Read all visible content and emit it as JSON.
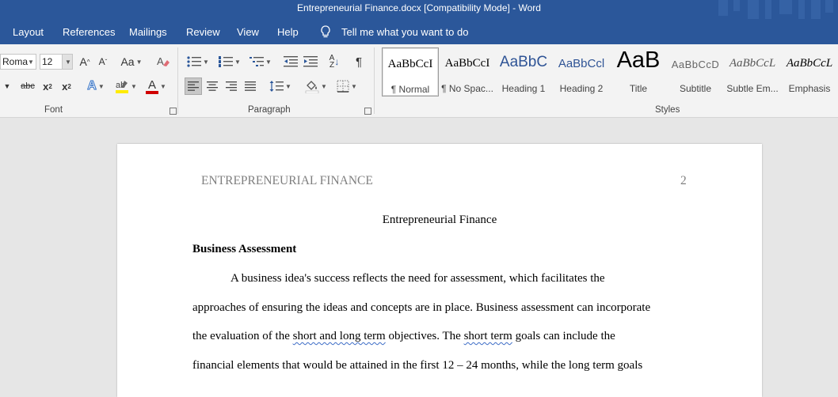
{
  "window": {
    "title": "Entrepreneurial Finance.docx [Compatibility Mode]  -  Word"
  },
  "tabs": [
    "Layout",
    "References",
    "Mailings",
    "Review",
    "View",
    "Help"
  ],
  "tell_me": {
    "placeholder": "Tell me what you want to do"
  },
  "font_group": {
    "label": "Font",
    "font_name": "Roma",
    "font_size": "12",
    "grow": "A",
    "shrink": "A",
    "change_case": "Aa",
    "strikethrough": "abc",
    "subscript": "x",
    "subscript_mark": "2",
    "superscript": "x",
    "superscript_mark": "2",
    "text_effects": "A",
    "font_color": "A"
  },
  "paragraph_group": {
    "label": "Paragraph",
    "sort": "A",
    "pilcrow": "¶"
  },
  "styles_group": {
    "label": "Styles",
    "items": [
      {
        "preview": "AaBbCcI",
        "name": "¶ Normal"
      },
      {
        "preview": "AaBbCcI",
        "name": "¶ No Spac..."
      },
      {
        "preview": "AaBbC",
        "name": "Heading 1"
      },
      {
        "preview": "AaBbCcl",
        "name": "Heading 2"
      },
      {
        "preview": "AaB",
        "name": "Title"
      },
      {
        "preview": "AaBbCcD",
        "name": "Subtitle"
      },
      {
        "preview": "AaBbCcL",
        "name": "Subtle Em..."
      },
      {
        "preview": "AaBbCcL",
        "name": "Emphasis"
      }
    ]
  },
  "document": {
    "header_text": "ENTREPRENEURIAL FINANCE",
    "page_number": "2",
    "title": "Entrepreneurial Finance",
    "heading": "Business Assessment",
    "lines": [
      [
        {
          "t": "A business idea's success reflects the need for assessment, which facilitates the"
        }
      ],
      [
        {
          "t": "approaches of ensuring the ideas and concepts are in place. Business assessment can incorporate"
        }
      ],
      [
        {
          "t": "the evaluation of the "
        },
        {
          "t": "short and long term",
          "err": true
        },
        {
          "t": " objectives. The "
        },
        {
          "t": "short term",
          "err": true
        },
        {
          "t": " goals can include the"
        }
      ],
      [
        {
          "t": "financial elements that would be attained in the first 12 – 24 months, while the long term goals"
        }
      ]
    ]
  },
  "colors": {
    "brand": "#2b579a",
    "ribbon": "#f3f3f3",
    "canvas": "#e6e6e6",
    "highlight": "#ffeb00",
    "font_color": "#d00000",
    "heading_blue": "#2e5395"
  }
}
